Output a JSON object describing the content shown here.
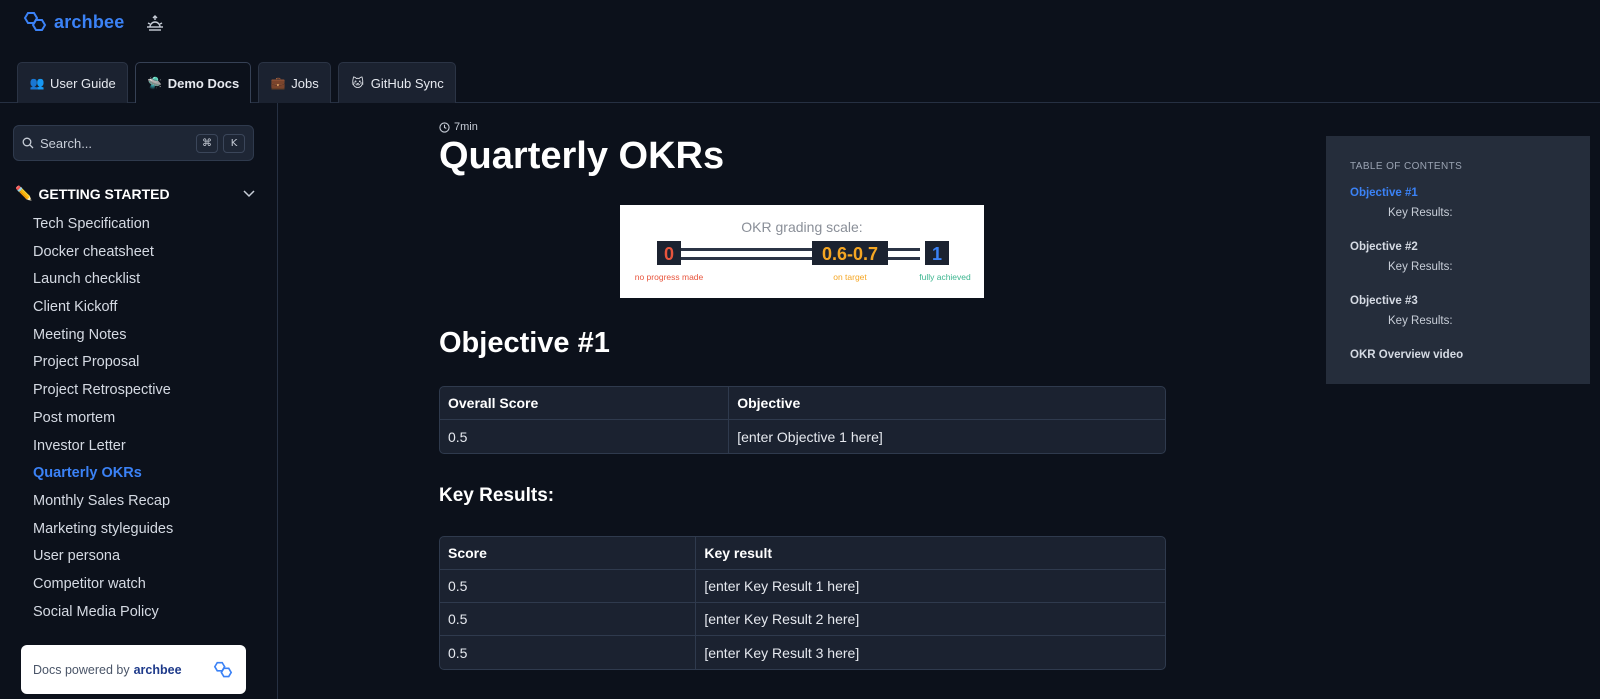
{
  "header": {
    "brand": "archbee",
    "tabs": [
      {
        "label": "User Guide",
        "icon": "people-icon"
      },
      {
        "label": "Demo Docs",
        "icon": "ufo-icon"
      },
      {
        "label": "Jobs",
        "icon": "briefcase-icon"
      },
      {
        "label": "GitHub Sync",
        "icon": "cat-icon"
      }
    ],
    "active_tab": "Demo Docs"
  },
  "sidebar": {
    "search_placeholder": "Search...",
    "shortcut_keys": [
      "⌘",
      "K"
    ],
    "section_title": "GETTING STARTED",
    "items": [
      {
        "label": "Tech Specification"
      },
      {
        "label": "Docker cheatsheet"
      },
      {
        "label": "Launch checklist"
      },
      {
        "label": "Client Kickoff"
      },
      {
        "label": "Meeting Notes"
      },
      {
        "label": "Project Proposal"
      },
      {
        "label": "Project Retrospective"
      },
      {
        "label": "Post mortem"
      },
      {
        "label": "Investor Letter"
      },
      {
        "label": "Quarterly OKRs"
      },
      {
        "label": "Monthly Sales Recap"
      },
      {
        "label": "Marketing styleguides"
      },
      {
        "label": "User persona"
      },
      {
        "label": "Competitor watch"
      },
      {
        "label": "Social Media Policy"
      }
    ],
    "active_item": "Quarterly OKRs",
    "powered_by_text": "Docs powered by",
    "powered_by_brand": "archbee"
  },
  "main": {
    "read_time": "7min",
    "title": "Quarterly OKRs",
    "okr_image": {
      "caption": "OKR grading scale:",
      "low_value": "0",
      "mid_value": "0.6-0.7",
      "high_value": "1",
      "low_label": "no progress made",
      "mid_label": "on target",
      "high_label": "fully achieved",
      "low_color": "#e8553d",
      "mid_color": "#f5a623",
      "high_color": "#3bb58f"
    },
    "objective_heading": "Objective #1",
    "objective_table": {
      "headers": [
        "Overall Score",
        "Objective"
      ],
      "rows": [
        [
          "0.5",
          "[enter Objective 1 here]"
        ]
      ]
    },
    "key_results_heading": "Key Results:",
    "key_results_table": {
      "headers": [
        "Score",
        "Key result"
      ],
      "rows": [
        [
          "0.5",
          "[enter Key Result 1 here]"
        ],
        [
          "0.5",
          "[enter Key Result 2 here]"
        ],
        [
          "0.5",
          "[enter Key Result 3 here]"
        ]
      ]
    }
  },
  "toc": {
    "title": "TABLE OF CONTENTS",
    "entries": [
      {
        "label": "Objective #1",
        "sub": "Key Results:"
      },
      {
        "label": "Objective #2",
        "sub": "Key Results:"
      },
      {
        "label": "Objective #3",
        "sub": "Key Results:"
      },
      {
        "label": "OKR Overview video"
      }
    ],
    "active": "Objective #1"
  },
  "colors": {
    "accent": "#3b82f6",
    "background": "#0c111b",
    "surface": "#1b2230"
  }
}
